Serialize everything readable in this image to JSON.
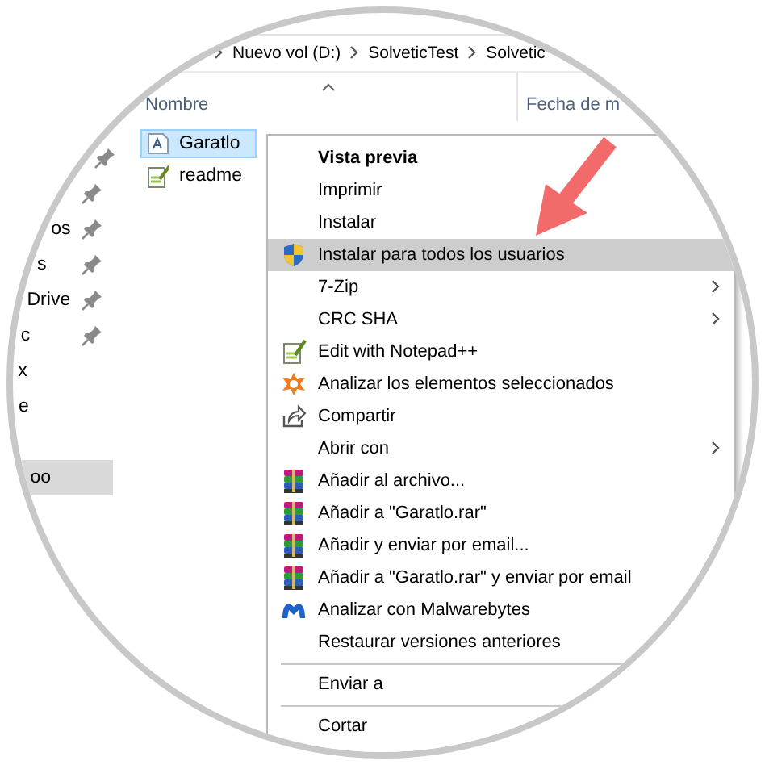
{
  "address": {
    "crumbs": [
      "Nuevo vol (D:)",
      "SolveticTest",
      "Solvetic"
    ]
  },
  "columns": [
    {
      "label": "Nombre",
      "sorted": true
    },
    {
      "label": "Fecha de m",
      "sorted": false
    }
  ],
  "nav_pane": {
    "items": [
      {
        "pinned": true,
        "selected": false
      },
      {
        "pinned": true,
        "selected": false
      },
      {
        "label": "os",
        "pinned": true,
        "selected": false
      },
      {
        "label": "s",
        "pinned": true,
        "selected": false
      },
      {
        "label": "Drive",
        "pinned": true,
        "selected": false
      },
      {
        "label": "c",
        "pinned": true,
        "selected": false
      },
      {
        "label": "x",
        "pinned": false,
        "selected": false
      },
      {
        "label": "e",
        "pinned": false,
        "selected": false
      },
      {
        "label": "oo",
        "pinned": false,
        "selected": true
      }
    ]
  },
  "files": [
    {
      "name": "Garatlo",
      "kind": "font",
      "selected": true
    },
    {
      "name": "readme",
      "kind": "text",
      "selected": false
    }
  ],
  "context_menu": {
    "items": [
      {
        "kind": "plain",
        "label": "Vista previa",
        "default": true,
        "submenu": false,
        "highlighted": false
      },
      {
        "kind": "plain",
        "label": "Imprimir",
        "default": false,
        "submenu": false,
        "highlighted": false
      },
      {
        "kind": "plain",
        "label": "Instalar",
        "default": false,
        "submenu": false,
        "highlighted": false
      },
      {
        "kind": "shield",
        "label": "Instalar para todos los usuarios",
        "default": false,
        "submenu": false,
        "highlighted": true
      },
      {
        "kind": "plain",
        "label": "7-Zip",
        "default": false,
        "submenu": true,
        "highlighted": false
      },
      {
        "kind": "plain",
        "label": "CRC SHA",
        "default": false,
        "submenu": true,
        "highlighted": false
      },
      {
        "kind": "notepad",
        "label": "Edit with Notepad++",
        "default": false,
        "submenu": false,
        "highlighted": false
      },
      {
        "kind": "scan",
        "label": "Analizar los elementos seleccionados",
        "default": false,
        "submenu": false,
        "highlighted": false
      },
      {
        "kind": "share",
        "label": "Compartir",
        "default": false,
        "submenu": false,
        "highlighted": false
      },
      {
        "kind": "plain",
        "label": "Abrir con",
        "default": false,
        "submenu": true,
        "highlighted": false
      },
      {
        "kind": "archive",
        "label": "Añadir al archivo...",
        "default": false,
        "submenu": false,
        "highlighted": false
      },
      {
        "kind": "archive",
        "label": "Añadir a \"Garatlo.rar\"",
        "default": false,
        "submenu": false,
        "highlighted": false
      },
      {
        "kind": "archive",
        "label": "Añadir y enviar por email...",
        "default": false,
        "submenu": false,
        "highlighted": false
      },
      {
        "kind": "archive",
        "label": "Añadir a \"Garatlo.rar\" y enviar por email",
        "default": false,
        "submenu": false,
        "highlighted": false
      },
      {
        "kind": "malware",
        "label": "Analizar con Malwarebytes",
        "default": false,
        "submenu": false,
        "highlighted": false
      },
      {
        "kind": "plain",
        "label": "Restaurar versiones anteriores",
        "default": false,
        "submenu": false,
        "highlighted": false
      },
      {
        "kind": "separator"
      },
      {
        "kind": "plain",
        "label": "Enviar a",
        "default": false,
        "submenu": false,
        "highlighted": false
      },
      {
        "kind": "separator"
      },
      {
        "kind": "plain",
        "label": "Cortar",
        "default": false,
        "submenu": false,
        "highlighted": false
      }
    ]
  }
}
